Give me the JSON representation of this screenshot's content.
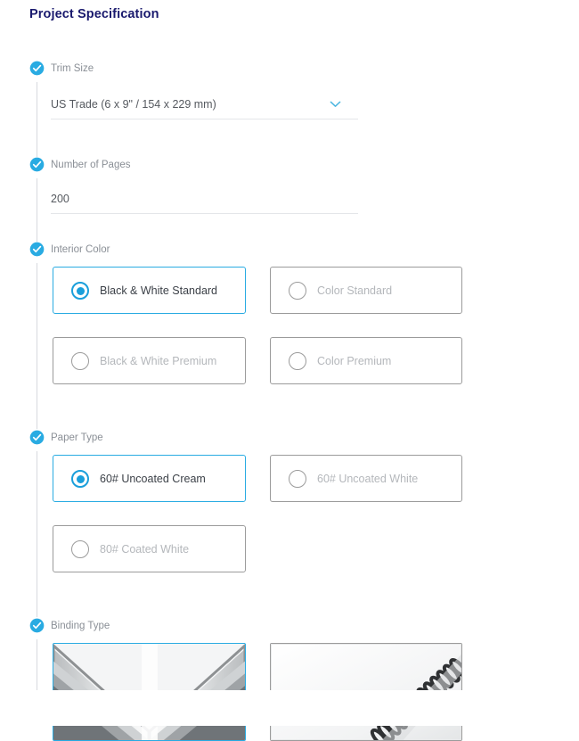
{
  "page": {
    "title": "Project Specification"
  },
  "icons": {
    "check": "check-circle-icon",
    "chevron": "chevron-down-icon",
    "radio": "radio-button-icon"
  },
  "colors": {
    "title": "#1a1a6e",
    "accent": "#29abe2",
    "radio_selected": "#1a9fdb",
    "label": "#8a8f96",
    "value": "#55595f",
    "disabled_label": "#b4b7bb",
    "card_border": "#9b9b9b",
    "rail": "#d8dade",
    "underline": "#e4e6e9"
  },
  "sections": {
    "trim_size": {
      "label": "Trim Size",
      "complete": true,
      "control": "select",
      "value": "US Trade (6 x 9\" / 154 x 229 mm)"
    },
    "number_of_pages": {
      "label": "Number of Pages",
      "complete": true,
      "control": "text",
      "value": "200",
      "placeholder": "Number of Pages"
    },
    "interior_color": {
      "label": "Interior Color",
      "complete": true,
      "control": "radio-cards",
      "options": [
        {
          "label": "Black & White Standard",
          "selected": true
        },
        {
          "label": "Color Standard",
          "selected": false
        },
        {
          "label": "Black & White Premium",
          "selected": false
        },
        {
          "label": "Color Premium",
          "selected": false
        }
      ]
    },
    "paper_type": {
      "label": "Paper Type",
      "complete": true,
      "control": "radio-cards",
      "options": [
        {
          "label": "60# Uncoated Cream",
          "selected": true
        },
        {
          "label": "60# Uncoated White",
          "selected": false
        },
        {
          "label": "80# Coated White",
          "selected": false
        }
      ]
    },
    "binding_type": {
      "label": "Binding Type",
      "complete": true,
      "control": "image-cards",
      "options": [
        {
          "image": "perfect-bound-book-thumbnail",
          "selected": true
        },
        {
          "image": "coil-bound-book-thumbnail",
          "selected": false
        }
      ]
    }
  }
}
